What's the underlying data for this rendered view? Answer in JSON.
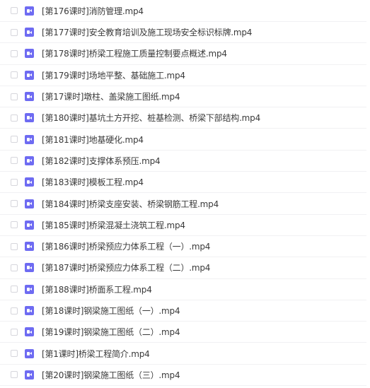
{
  "file_list": {
    "icon": "video-file-icon",
    "accent_color": "#6e6bf2",
    "items": [
      {
        "name": "[第176课时]消防管理.mp4"
      },
      {
        "name": "[第177课时]安全教育培训及施工现场安全标识标牌.mp4"
      },
      {
        "name": "[第178课时]桥梁工程施工质量控制要点概述.mp4"
      },
      {
        "name": "[第179课时]场地平整、基础施工.mp4"
      },
      {
        "name": "[第17课时]墩柱、盖梁施工图纸.mp4"
      },
      {
        "name": "[第180课时]基坑土方开挖、桩基检测、桥梁下部结构.mp4"
      },
      {
        "name": "[第181课时]地基硬化.mp4"
      },
      {
        "name": "[第182课时]支撑体系预压.mp4"
      },
      {
        "name": "[第183课时]模板工程.mp4"
      },
      {
        "name": "[第184课时]桥梁支座安装、桥梁钢筋工程.mp4"
      },
      {
        "name": "[第185课时]桥梁混凝土浇筑工程.mp4"
      },
      {
        "name": "[第186课时]桥梁预应力体系工程（一）.mp4"
      },
      {
        "name": "[第187课时]桥梁预应力体系工程（二）.mp4"
      },
      {
        "name": "[第188课时]桥面系工程.mp4"
      },
      {
        "name": "[第18课时]钢梁施工图纸（一）.mp4"
      },
      {
        "name": "[第19课时]钢梁施工图纸（二）.mp4"
      },
      {
        "name": "[第1课时]桥梁工程简介.mp4"
      },
      {
        "name": "[第20课时]钢梁施工图纸（三）.mp4"
      }
    ]
  }
}
